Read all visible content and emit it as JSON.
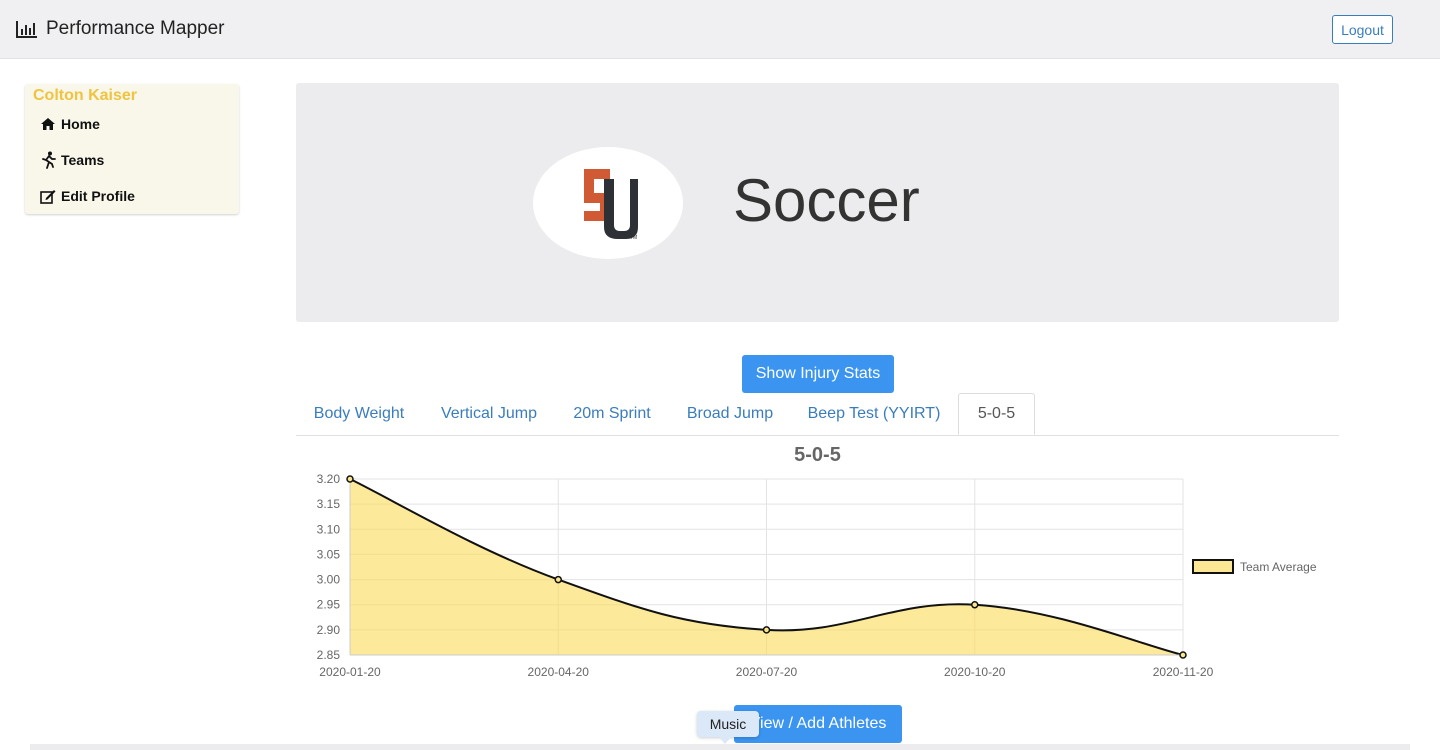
{
  "app": {
    "title": "Performance Mapper"
  },
  "header": {
    "logout_label": "Logout"
  },
  "sidebar": {
    "user_name": "Colton Kaiser",
    "items": [
      {
        "label": "Home",
        "icon": "home-icon"
      },
      {
        "label": "Teams",
        "icon": "running-icon"
      },
      {
        "label": "Edit Profile",
        "icon": "edit-icon"
      }
    ]
  },
  "hero": {
    "team_name": "Soccer",
    "logo_letters": "SU"
  },
  "buttons": {
    "injury_stats": "Show Injury Stats",
    "view_add_athletes": "View / Add Athletes"
  },
  "tabs": [
    {
      "label": "Body Weight",
      "active": false
    },
    {
      "label": "Vertical Jump",
      "active": false
    },
    {
      "label": "20m Sprint",
      "active": false
    },
    {
      "label": "Broad Jump",
      "active": false
    },
    {
      "label": "Beep Test (YYIRT)",
      "active": false
    },
    {
      "label": "5-0-5",
      "active": true
    }
  ],
  "tooltip": {
    "text": "Music"
  },
  "colors": {
    "accent": "#3a94f0",
    "link": "#3a7dbd",
    "sidebar_user": "#f0c43f",
    "chart_fill": "#fbe68e",
    "chart_line": "#111111"
  },
  "chart_data": {
    "type": "area",
    "title": "5-0-5",
    "x": [
      "2020-01-20",
      "2020-04-20",
      "2020-07-20",
      "2020-10-20",
      "2020-11-20"
    ],
    "series": [
      {
        "name": "Team Average",
        "values": [
          3.2,
          3.0,
          2.9,
          2.95,
          2.85
        ]
      }
    ],
    "ylim": [
      2.85,
      3.2
    ],
    "y_ticks": [
      "3.20",
      "3.15",
      "3.10",
      "3.05",
      "3.00",
      "2.95",
      "2.90",
      "2.85"
    ],
    "grid": true,
    "legend_position": "right"
  }
}
